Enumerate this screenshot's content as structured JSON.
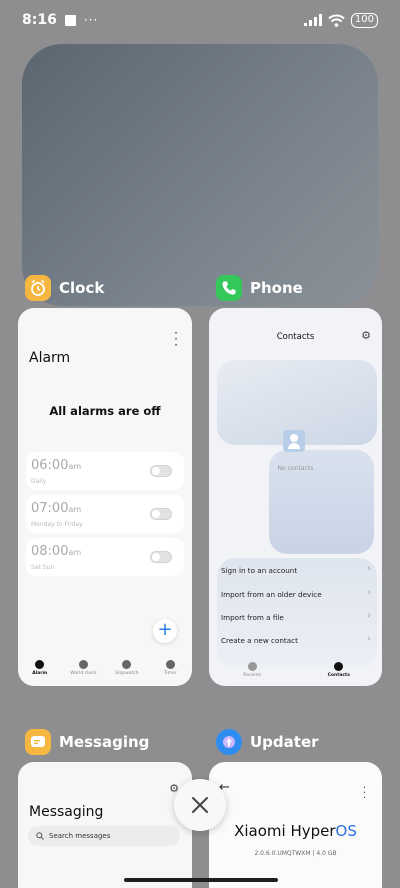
{
  "status_bar": {
    "time": "8:16",
    "dots": "···",
    "battery": "100"
  },
  "apps": {
    "clock": {
      "label": "Clock",
      "icon": "alarm-clock-icon",
      "icon_color": "#f6b740",
      "title": "Alarm",
      "heading": "All alarms are off",
      "alarms": [
        {
          "time": "06:00",
          "ampm": "am",
          "repeat": "Daily"
        },
        {
          "time": "07:00",
          "ampm": "am",
          "repeat": "Monday to Friday"
        },
        {
          "time": "08:00",
          "ampm": "am",
          "repeat": "Sat Sun"
        }
      ],
      "nav": [
        "Alarm",
        "World clock",
        "Stopwatch",
        "Timer"
      ]
    },
    "phone": {
      "label": "Phone",
      "icon": "phone-icon",
      "icon_color": "#34c759",
      "title": "Contacts",
      "empty": "No contacts",
      "actions": [
        "Sign in to an account",
        "Import from an older device",
        "Import from a file",
        "Create a new contact"
      ],
      "nav": [
        "Recents",
        "Contacts"
      ]
    },
    "messaging": {
      "label": "Messaging",
      "icon": "message-icon",
      "icon_color": "#f6b740",
      "title": "Messaging",
      "search_placeholder": "Search messages"
    },
    "updater": {
      "label": "Updater",
      "icon": "updater-icon",
      "icon_color": "#2f8cf0",
      "brand_main": "Xiaomi Hyper",
      "brand_accent": "OS",
      "version": "2.0.6.0.UMQTWXM | 4.0 GB"
    }
  }
}
